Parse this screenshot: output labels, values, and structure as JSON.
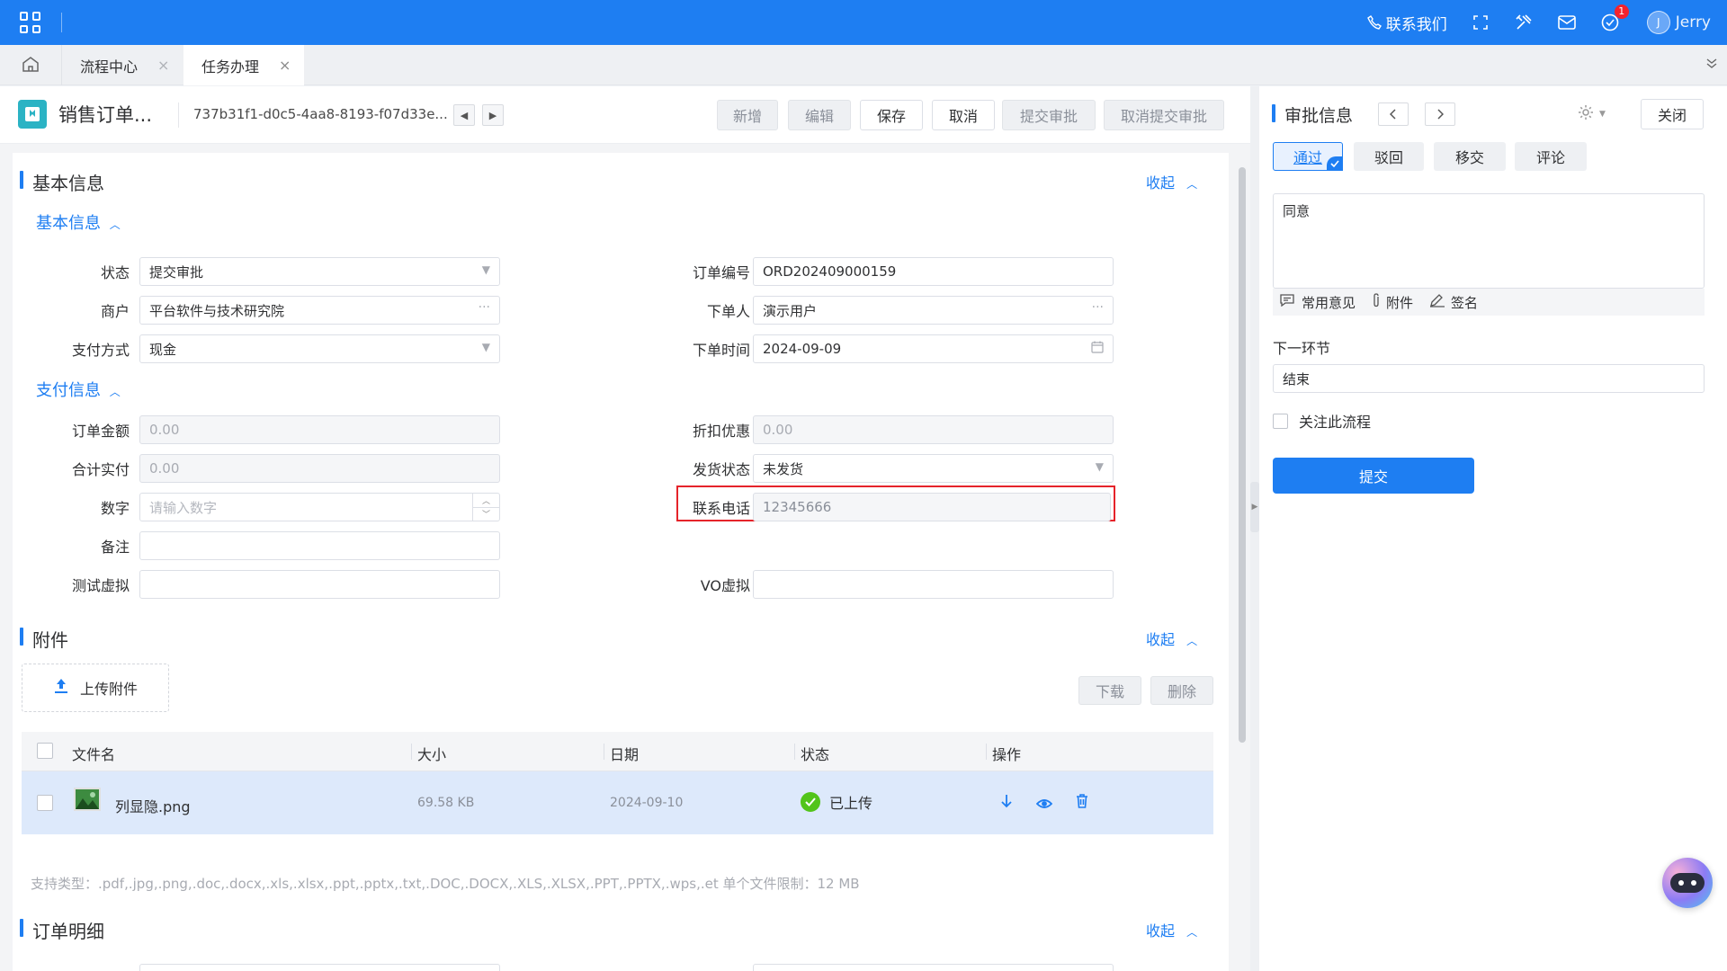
{
  "topbar": {
    "contact": "联系我们",
    "badge": "1",
    "avatar_letter": "J",
    "user": "Jerry"
  },
  "tabs": [
    {
      "label": "流程中心",
      "close": "×"
    },
    {
      "label": "任务办理",
      "close": "×"
    }
  ],
  "doc": {
    "title": "销售订单...",
    "id": "737b31f1-d0c5-4aa8-8193-f07d33e...",
    "buttons": {
      "add": "新增",
      "edit": "编辑",
      "save": "保存",
      "cancel": "取消",
      "submit_approval": "提交审批",
      "cancel_submit": "取消提交审批"
    }
  },
  "basic_section": {
    "title": "基本信息",
    "collapse": "收起",
    "sub1": "基本信息",
    "sub2": "支付信息"
  },
  "fields": {
    "status": {
      "label": "状态",
      "value": "提交审批"
    },
    "order_no": {
      "label": "订单编号",
      "value": "ORD202409000159"
    },
    "merchant": {
      "label": "商户",
      "value": "平台软件与技术研究院"
    },
    "orderer": {
      "label": "下单人",
      "value": "演示用户"
    },
    "payment": {
      "label": "支付方式",
      "value": "现金"
    },
    "order_time": {
      "label": "下单时间",
      "value": "2024-09-09"
    },
    "amount": {
      "label": "订单金额",
      "value": "0.00"
    },
    "discount": {
      "label": "折扣优惠",
      "value": "0.00"
    },
    "total_paid": {
      "label": "合计实付",
      "value": "0.00"
    },
    "ship_status": {
      "label": "发货状态",
      "value": "未发货"
    },
    "number": {
      "label": "数字",
      "placeholder": "请输入数字"
    },
    "phone": {
      "label": "联系电话",
      "value": "12345666"
    },
    "remark": {
      "label": "备注",
      "value": ""
    },
    "test_virtual": {
      "label": "测试虚拟",
      "value": ""
    },
    "vo_virtual": {
      "label": "VO虚拟",
      "value": ""
    }
  },
  "attach_section": {
    "title": "附件",
    "collapse": "收起",
    "upload": "上传附件",
    "download": "下载",
    "delete": "删除",
    "columns": [
      "文件名",
      "大小",
      "日期",
      "状态",
      "操作"
    ],
    "rows": [
      {
        "name": "列显隐.png",
        "size": "69.58 KB",
        "date": "2024-09-10",
        "status": "已上传"
      }
    ],
    "hint": "支持类型：.pdf,.jpg,.png,.doc,.docx,.xls,.xlsx,.ppt,.pptx,.txt,.DOC,.DOCX,.XLS,.XLSX,.PPT,.PPTX,.wps,.et   单个文件限制：12 MB"
  },
  "detail_section": {
    "title": "订单明细",
    "collapse": "收起"
  },
  "approval": {
    "title": "审批信息",
    "close": "关闭",
    "tabs": [
      "通过",
      "驳回",
      "移交",
      "评论"
    ],
    "comment": "同意",
    "tools": {
      "common": "常用意见",
      "attach": "附件",
      "sign": "签名"
    },
    "next_label": "下一环节",
    "next_value": "结束",
    "follow": "关注此流程",
    "submit": "提交"
  },
  "colors": {
    "primary": "#1e7ef2",
    "highlight": "#e5232a",
    "success": "#52c41a"
  }
}
